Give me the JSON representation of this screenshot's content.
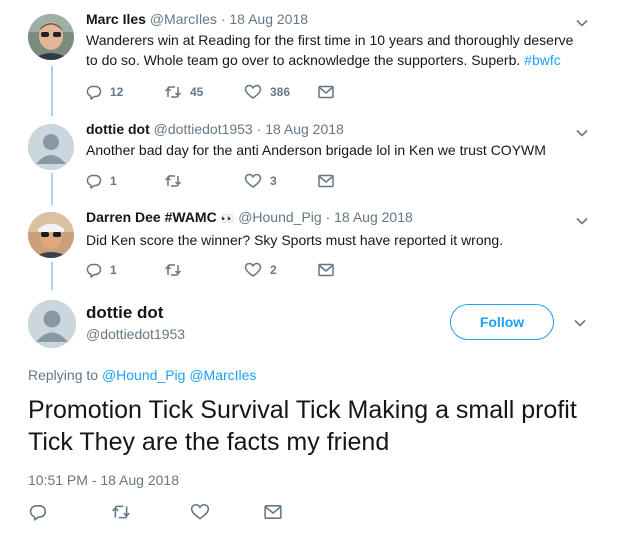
{
  "replies": [
    {
      "name": "Marc Iles",
      "handle": "@MarcIles",
      "dot": "·",
      "date": "18 Aug 2018",
      "text": "Wanderers win at Reading for the first time in 10 years and thoroughly deserve to do so. Whole team go over to acknowledge the supporters. Superb.",
      "hashtag": "#bwfc",
      "reply_count": "12",
      "retweet_count": "45",
      "like_count": "386"
    },
    {
      "name": "dottie dot",
      "handle": "@dottiedot1953",
      "dot": "·",
      "date": "18 Aug 2018",
      "text": "Another bad day for the anti Anderson brigade lol in Ken we trust COYWM",
      "hashtag": "",
      "reply_count": "1",
      "retweet_count": "",
      "like_count": "3"
    },
    {
      "name": "Darren Dee #WAMC",
      "name_emoji": "👀",
      "handle": "@Hound_Pig",
      "dot": "·",
      "date": "18 Aug 2018",
      "text": "Did Ken score the winner? Sky Sports must have reported it wrong.",
      "hashtag": "",
      "reply_count": "1",
      "retweet_count": "",
      "like_count": "2"
    }
  ],
  "main": {
    "name": "dottie dot",
    "handle": "@dottiedot1953",
    "follow_label": "Follow",
    "replying_prefix": "Replying to",
    "replying_to": "@Hound_Pig @MarcIles",
    "text": "Promotion Tick Survival Tick Making a small profit Tick They are the facts my friend",
    "timestamp": "10:51 PM - 18 Aug 2018"
  },
  "icons": {
    "reply": "reply-icon",
    "retweet": "retweet-icon",
    "like": "heart-icon",
    "dm": "envelope-icon",
    "more": "chevron-down-icon"
  },
  "colors": {
    "accent": "#1da1f2",
    "muted": "#657786",
    "thread_line": "#a6d4f2",
    "text": "#14171a"
  }
}
